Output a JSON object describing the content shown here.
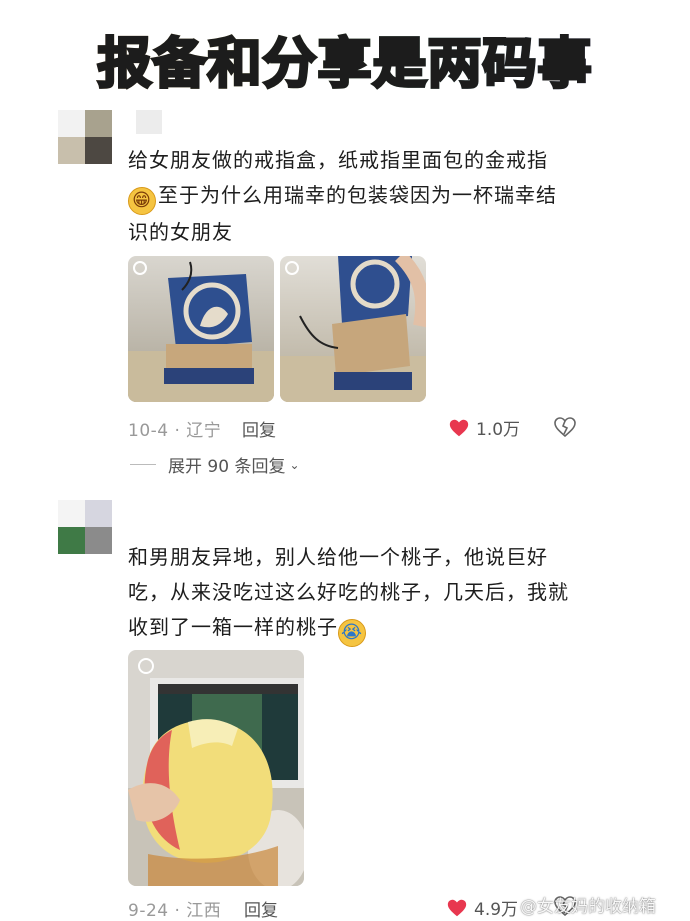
{
  "title": "报备和分享是两码事",
  "comments": [
    {
      "text_line1": "给女朋友做的戒指盒，纸戒指里面包的金戒指",
      "text_line2": "至于为什么用瑞幸的包装袋因为一杯瑞幸结",
      "text_line3": "识的女朋友",
      "emoji": "grin-emoji",
      "date_location": "10-4 · 辽宁",
      "reply_label": "回复",
      "likes": "1.0万",
      "expand_label": "展开 90 条回复"
    },
    {
      "text_line1": "和男朋友异地，别人给他一个桃子，他说巨好",
      "text_line2": "吃，从来没吃过这么好吃的桃子，几天后，我就",
      "text_line3": "收到了一箱一样的桃子",
      "emoji": "crying-emoji",
      "date_location": "9-24 · 江西",
      "reply_label": "回复",
      "likes": "4.9万"
    }
  ],
  "watermark": "@女友妈的收纳箱",
  "colors": {
    "heart": "#e8374f",
    "meta": "#999999",
    "text": "#1d1d1d"
  }
}
